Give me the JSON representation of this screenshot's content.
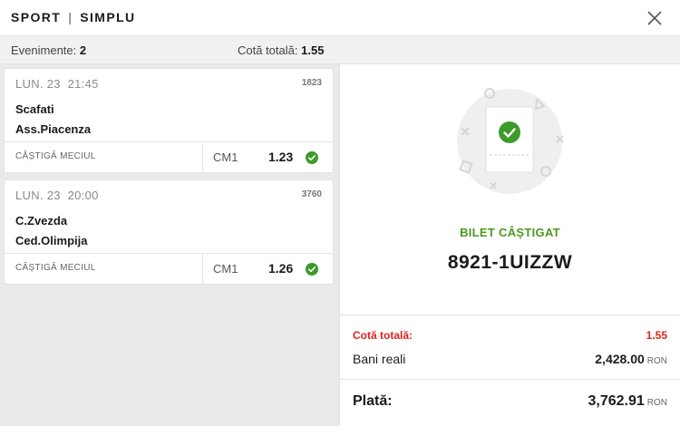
{
  "header": {
    "title_left": "SPORT",
    "title_right": "SIMPLU",
    "separator": "|",
    "close_icon": "close-icon"
  },
  "summary": {
    "events_label": "Evenimente:",
    "events_count": "2",
    "total_odds_label": "Cotă totală:",
    "total_odds_value": "1.55"
  },
  "events": [
    {
      "date": "LUN. 23",
      "time": "21:45",
      "code": "1823",
      "home": "Scafati",
      "away": "Ass.Piacenza",
      "market": "CÂȘTIGĂ MECIUL",
      "pick": "CM1",
      "odd": "1.23",
      "status_icon": "check-circle-icon"
    },
    {
      "date": "LUN. 23",
      "time": "20:00",
      "code": "3760",
      "home": "C.Zvezda",
      "away": "Ced.Olimpija",
      "market": "CÂȘTIGĂ MECIUL",
      "pick": "CM1",
      "odd": "1.26",
      "status_icon": "check-circle-icon"
    }
  ],
  "ticket": {
    "status": "BILET CÂȘTIGAT",
    "id": "8921-1UIZZW",
    "illustration_icon": "winning-ticket-icon"
  },
  "totals": {
    "odds_label": "Cotă totală:",
    "odds_value": "1.55",
    "stake_label": "Bani reali",
    "stake_value": "2,428.00",
    "stake_currency": "RON",
    "payout_label": "Plată:",
    "payout_value": "3,762.91",
    "payout_currency": "RON"
  },
  "colors": {
    "win_green": "#4c9a1d",
    "check_green": "#3d9a2b",
    "odds_red": "#e0221b",
    "panel_grey": "#eaeaea"
  }
}
